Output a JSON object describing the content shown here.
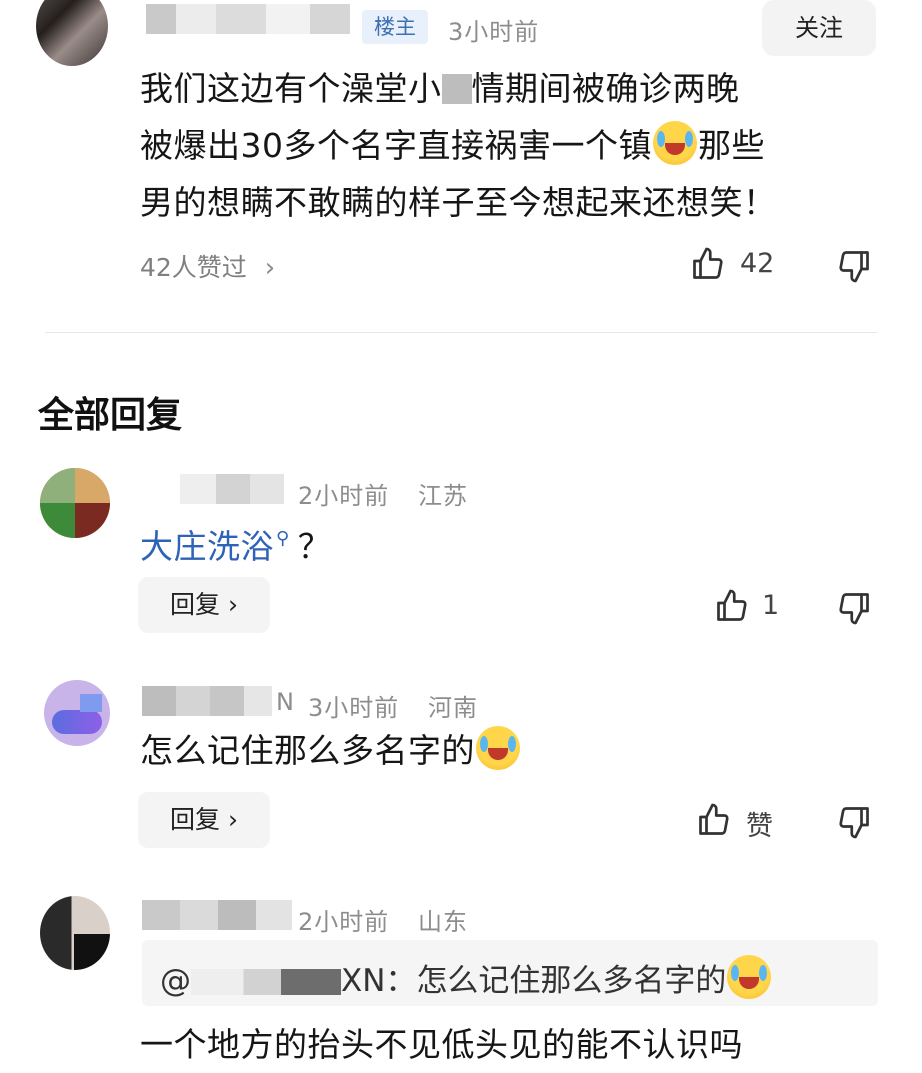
{
  "op_comment": {
    "badge": "楼主",
    "time": "3小时前",
    "follow": "关注",
    "text_1": "我们这边有个澡堂小",
    "text_2": "情期间被确诊两晚",
    "text_3": "被爆出30多个名字直接祸害一个镇",
    "text_4": "那些",
    "text_5": "男的想瞒不敢瞒的样子至今想起来还想笑！",
    "likers": "42人赞过",
    "like_count": "42",
    "emoji_icon": "laughing-crying-emoji"
  },
  "section": {
    "title": "全部回复"
  },
  "replies": [
    {
      "time": "2小时前",
      "location": "江苏",
      "link_text": "大庄洗浴",
      "suffix": "？",
      "reply_label": "回复",
      "like_count": "1"
    },
    {
      "name_tail": "N",
      "time": "3小时前",
      "location": "河南",
      "text": "怎么记住那么多名字的",
      "reply_label": "回复",
      "like_label": "赞"
    },
    {
      "time": "2小时前",
      "location": "山东",
      "quote_prefix": "@",
      "quote_name_tail": "XN：",
      "quote_text": "怎么记住那么多名字的",
      "text": "一个地方的抬头不见低头见的能不认识吗"
    }
  ],
  "colors": {
    "link": "#2f63b8",
    "badge_bg": "#e8f0fb",
    "badge_text": "#3f6fb3",
    "meta": "#8d8d8d"
  }
}
